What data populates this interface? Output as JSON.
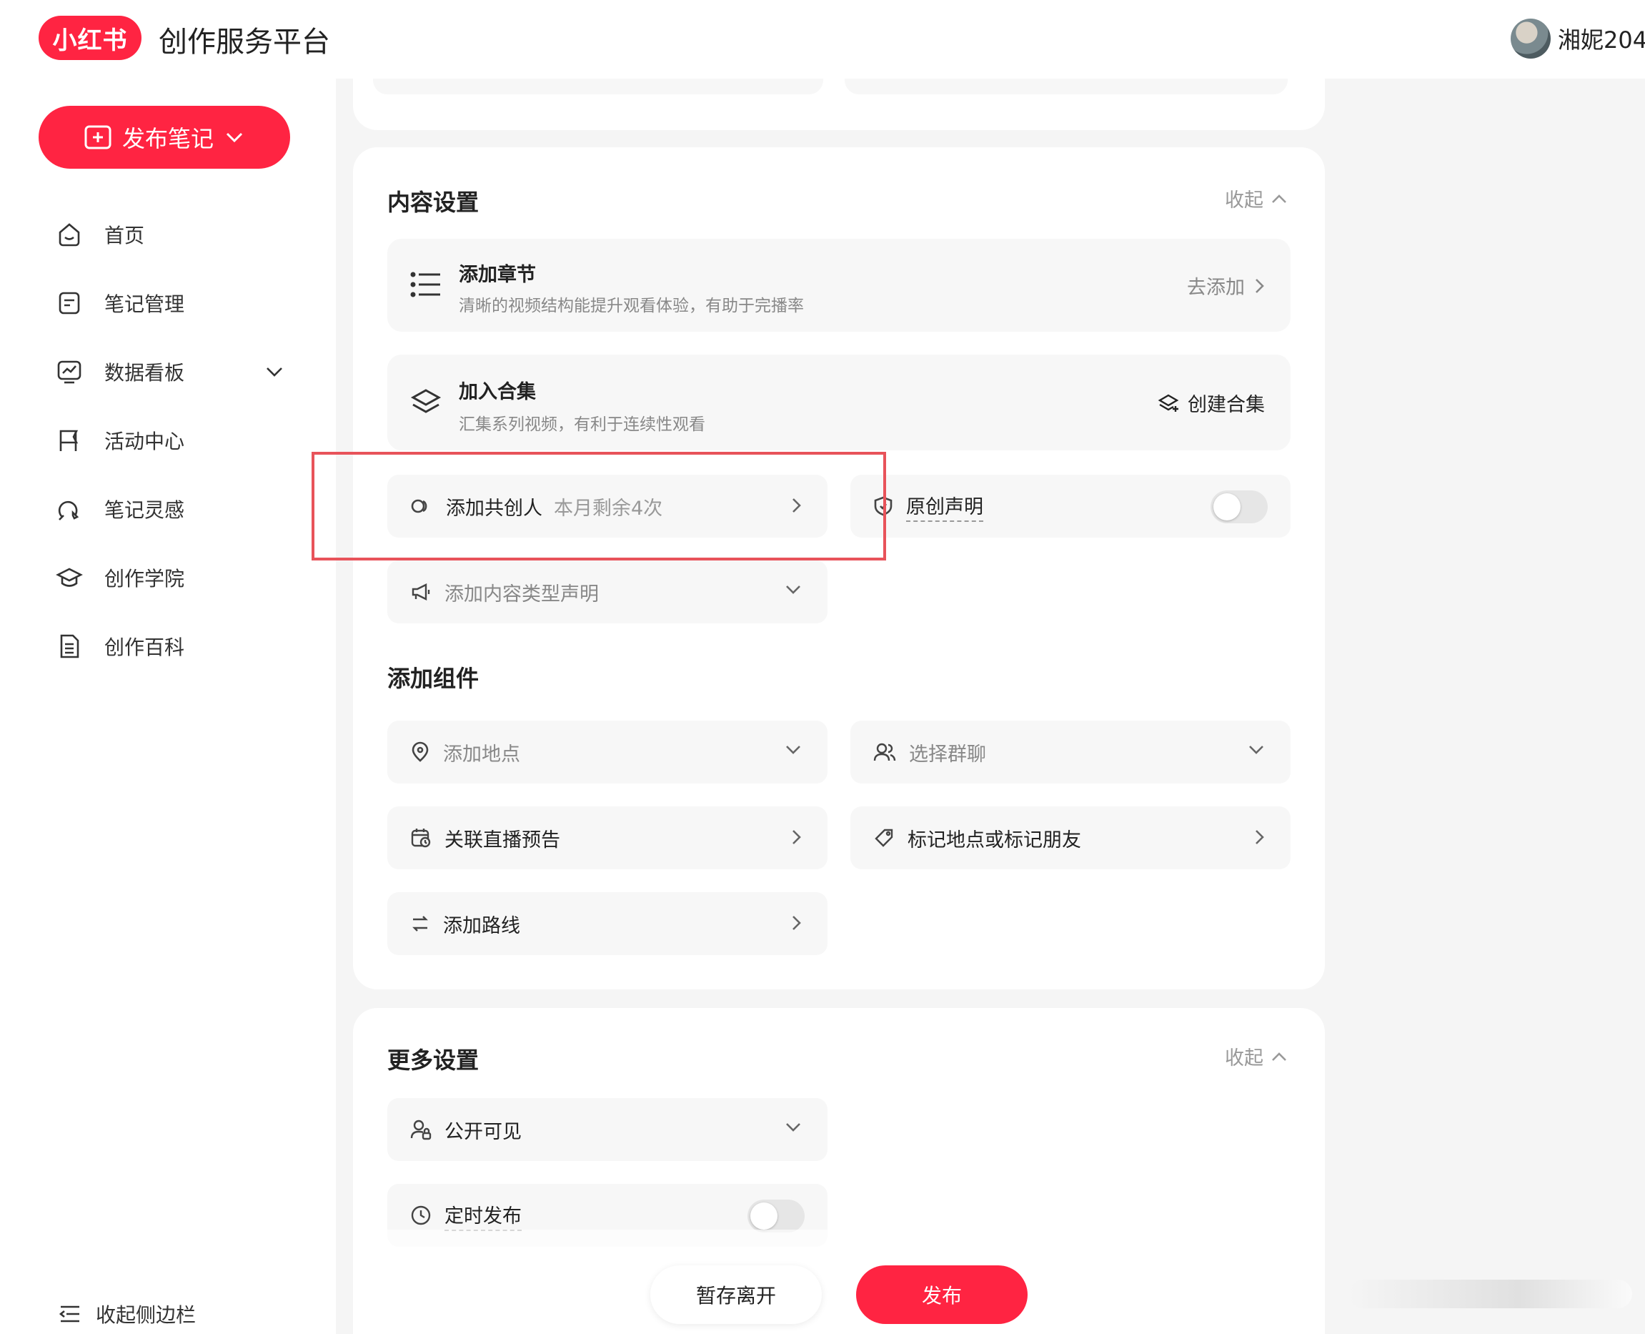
{
  "header": {
    "logo_text": "小红书",
    "app_title": "创作服务平台",
    "username": "湘妮204"
  },
  "sidebar": {
    "publish_label": "发布笔记",
    "items": [
      {
        "label": "首页",
        "icon": "home-icon"
      },
      {
        "label": "笔记管理",
        "icon": "note-icon"
      },
      {
        "label": "数据看板",
        "icon": "chart-icon",
        "expandable": true
      },
      {
        "label": "活动中心",
        "icon": "flag-icon"
      },
      {
        "label": "笔记灵感",
        "icon": "bulb-icon"
      },
      {
        "label": "创作学院",
        "icon": "graduation-cap-icon"
      },
      {
        "label": "创作百科",
        "icon": "book-icon"
      }
    ],
    "collapse_label": "收起侧边栏"
  },
  "content_settings": {
    "title": "内容设置",
    "fold_label": "收起",
    "chapter": {
      "title": "添加章节",
      "desc": "清晰的视频结构能提升观看体验，有助于完播率",
      "action": "去添加"
    },
    "collection": {
      "title": "加入合集",
      "desc": "汇集系列视频，有利于连续性观看",
      "action": "创建合集"
    },
    "co_creator": {
      "label": "添加共创人",
      "sub": "本月剩余4次"
    },
    "original": {
      "label": "原创声明",
      "enabled": false
    },
    "content_type": {
      "label": "添加内容类型声明"
    }
  },
  "components": {
    "title": "添加组件",
    "location": "添加地点",
    "group_chat": "选择群聊",
    "live_preview": "关联直播预告",
    "tag_friends": "标记地点或标记朋友",
    "route": "添加路线"
  },
  "more_settings": {
    "title": "更多设置",
    "fold_label": "收起",
    "visibility": "公开可见",
    "schedule": {
      "label": "定时发布",
      "enabled": false
    }
  },
  "footer": {
    "save_label": "暂存离开",
    "publish_label": "发布"
  },
  "colors": {
    "brand": "#ff2442",
    "highlight": "#e8535a"
  }
}
